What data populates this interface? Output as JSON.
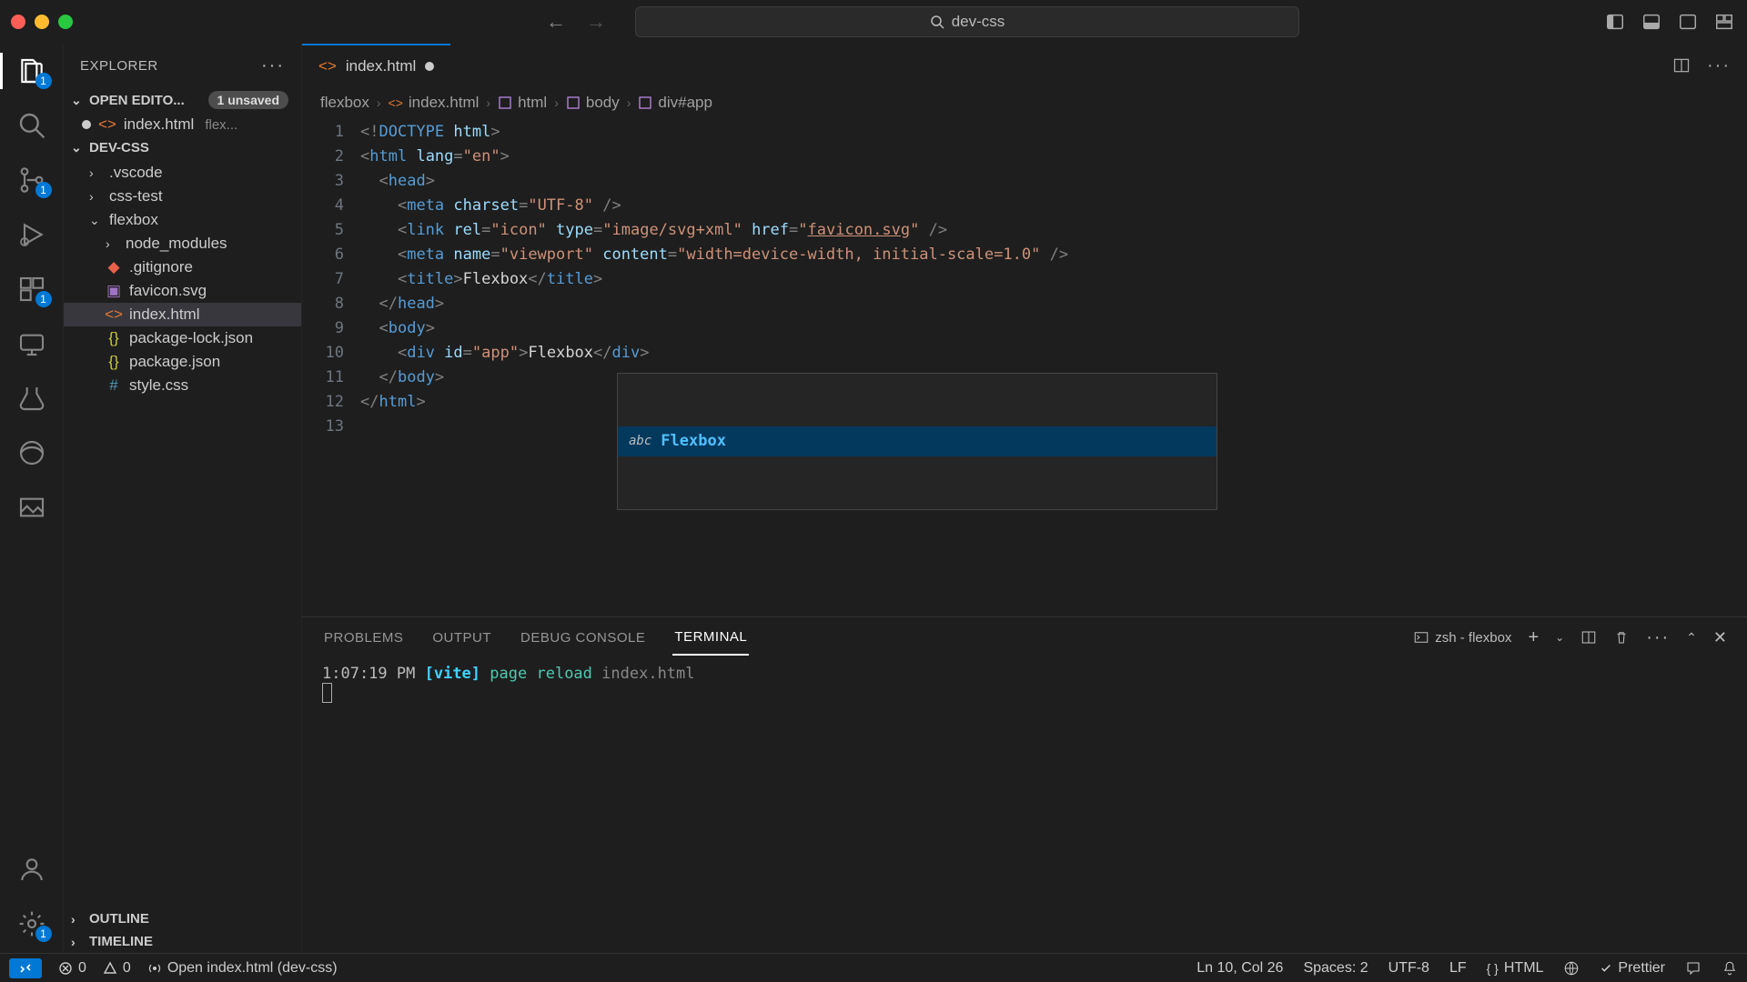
{
  "titlebar": {
    "search": "dev-css"
  },
  "sidebar": {
    "title": "EXPLORER",
    "open_editors_label": "OPEN EDITO...",
    "unsaved_badge": "1 unsaved",
    "open_editor_file": "index.html",
    "open_editor_hint": "flex...",
    "project_label": "DEV-CSS",
    "items": [
      {
        "name": ".vscode",
        "type": "folder"
      },
      {
        "name": "css-test",
        "type": "folder"
      },
      {
        "name": "flexbox",
        "type": "folder",
        "expanded": true
      },
      {
        "name": "node_modules",
        "type": "folder"
      },
      {
        "name": ".gitignore",
        "type": "git"
      },
      {
        "name": "favicon.svg",
        "type": "svg"
      },
      {
        "name": "index.html",
        "type": "html",
        "selected": true
      },
      {
        "name": "package-lock.json",
        "type": "json"
      },
      {
        "name": "package.json",
        "type": "json"
      },
      {
        "name": "style.css",
        "type": "css"
      }
    ],
    "outline_label": "OUTLINE",
    "timeline_label": "TIMELINE"
  },
  "tabs": {
    "active": {
      "name": "index.html",
      "dirty": true
    }
  },
  "breadcrumb": [
    "flexbox",
    "index.html",
    "html",
    "body",
    "div#app"
  ],
  "code": {
    "lines": 13,
    "title_text": "Flexbox",
    "div_text": "Flexbox",
    "href": "favicon.svg",
    "lang": "en",
    "charset": "UTF-8",
    "icon_type": "image/svg+xml",
    "viewport": "width=device-width, initial-scale=1.0",
    "app_id": "app"
  },
  "suggest": {
    "label_abc": "abc",
    "label_text": "Flexbox"
  },
  "panel": {
    "tabs": [
      "PROBLEMS",
      "OUTPUT",
      "DEBUG CONSOLE",
      "TERMINAL"
    ],
    "active": "TERMINAL",
    "shell": "zsh - flexbox",
    "terminal_lines": [
      {
        "time": "1:07:19 PM",
        "tag": "[vite]",
        "msg1": "page",
        "msg2": "reload",
        "file": "index.html"
      }
    ]
  },
  "status": {
    "errors": "0",
    "warnings": "0",
    "task": "Open index.html (dev-css)",
    "cursor": "Ln 10, Col 26",
    "spaces": "Spaces: 2",
    "encoding": "UTF-8",
    "eol": "LF",
    "lang": "HTML",
    "prettier": "Prettier"
  },
  "badges": {
    "explorer": "1",
    "scm": "1",
    "ext": "1",
    "settings": "1"
  }
}
